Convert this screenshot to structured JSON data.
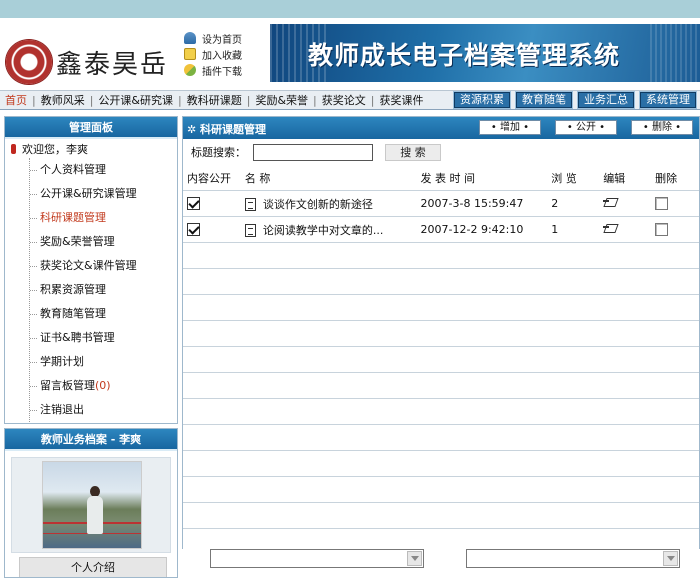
{
  "header": {
    "logo_text": "鑫泰昊岳",
    "quick_links": [
      {
        "label": "设为首页",
        "icon": "home-icon"
      },
      {
        "label": "加入收藏",
        "icon": "folder-icon"
      },
      {
        "label": "插件下载",
        "icon": "download-icon"
      }
    ],
    "banner_title": "教师成长电子档案管理系统"
  },
  "nav": {
    "links": [
      "首页",
      "教师风采",
      "公开课&研究课",
      "教科研课题",
      "奖励&荣誉",
      "获奖论文",
      "获奖课件"
    ],
    "buttons": [
      "资源积累",
      "教育随笔",
      "业务汇总",
      "系统管理"
    ]
  },
  "sidebar": {
    "title": "管理面板",
    "welcome": "欢迎您，李爽",
    "items": [
      {
        "label": "个人资料管理"
      },
      {
        "label": "公开课&研究课管理"
      },
      {
        "label": "科研课题管理"
      },
      {
        "label": "奖励&荣誉管理"
      },
      {
        "label": "获奖论文&课件管理"
      },
      {
        "label": "积累资源管理"
      },
      {
        "label": "教育随笔管理"
      },
      {
        "label": "证书&聘书管理"
      },
      {
        "label": "学期计划"
      },
      {
        "label": "留言板管理",
        "count": "(0)"
      },
      {
        "label": "注销退出"
      }
    ]
  },
  "profile": {
    "title": "教师业务档案 - 李爽",
    "intro_label": "个人介绍"
  },
  "main": {
    "title": "科研课题管理",
    "actions": [
      "• 增加 •",
      "• 公开 •",
      "• 删除 •"
    ],
    "search": {
      "label": "标题搜索：",
      "value": "",
      "button": "搜 索"
    },
    "columns": [
      "内容公开",
      "名 称",
      "发 表 时 间",
      "浏 览",
      "编辑",
      "删除"
    ],
    "rows": [
      {
        "public": true,
        "title": "谈谈作文创新的新途径",
        "date": "2007-3-8 15:59:47",
        "views": "2"
      },
      {
        "public": true,
        "title": "论阅读教学中对文章的...",
        "date": "2007-12-2 9:42:10",
        "views": "1"
      }
    ]
  }
}
